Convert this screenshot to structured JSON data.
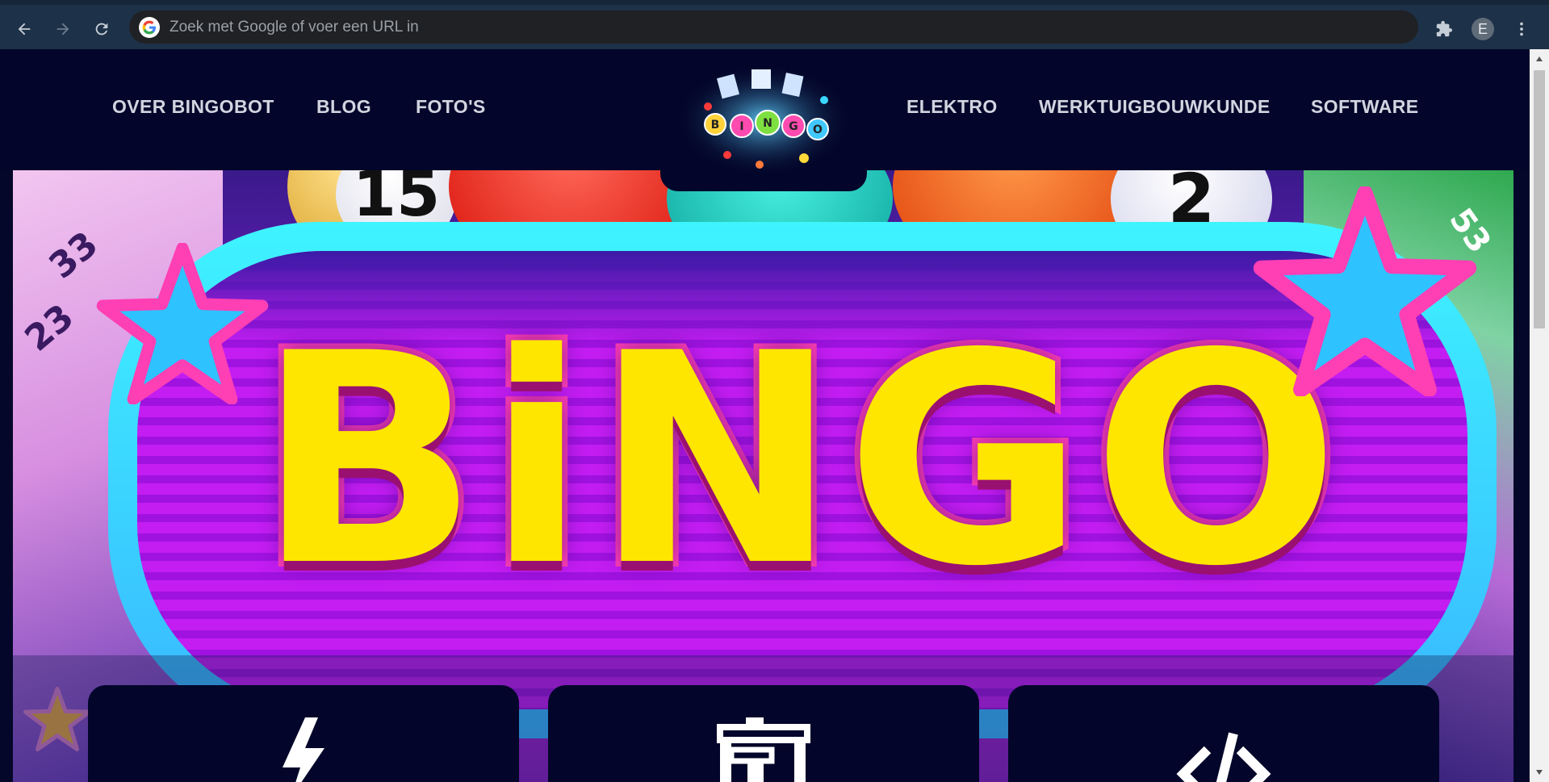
{
  "browser": {
    "omnibox_placeholder": "Zoek met Google of voer een URL in",
    "profile_initial": "E",
    "icons": {
      "back": "arrow-left-icon",
      "forward": "arrow-right-icon",
      "reload": "reload-icon",
      "google": "google-g-icon",
      "extensions": "puzzle-icon",
      "menu": "kebab-menu-icon"
    }
  },
  "site": {
    "nav_left": [
      {
        "label": "OVER BINGOBOT"
      },
      {
        "label": "BLOG"
      },
      {
        "label": "FOTO'S"
      }
    ],
    "nav_right": [
      {
        "label": "ELEKTRO"
      },
      {
        "label": "WERKTUIGBOUWKUNDE"
      },
      {
        "label": "SOFTWARE"
      }
    ],
    "logo_letters": [
      "B",
      "I",
      "N",
      "G",
      "O"
    ]
  },
  "hero": {
    "title": "BiNGO",
    "balls": [
      "15",
      "2",
      "33",
      "23",
      "53"
    ]
  },
  "cards": [
    {
      "icon": "lightning-icon"
    },
    {
      "icon": "machine-tool-icon"
    },
    {
      "icon": "code-icon"
    }
  ],
  "colors": {
    "header_bg": "#03062a",
    "nav_text": "#d2d4e0",
    "chrome_bg": "#1d3148",
    "bingo_yellow": "#ffe600",
    "bingo_pink": "#ff3fb4",
    "panel_cyan": "#3ef4ff"
  }
}
